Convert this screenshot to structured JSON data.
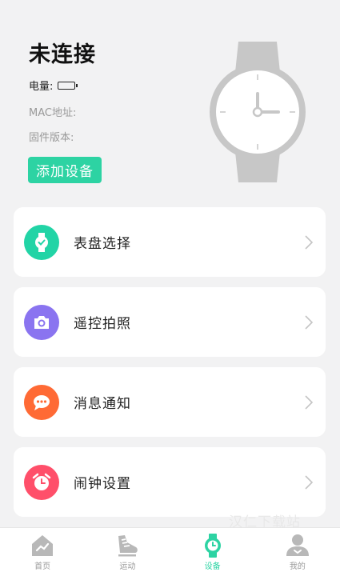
{
  "header": {
    "title": "未连接",
    "battery_label": "电量:",
    "mac_label": "MAC地址:",
    "firmware_label": "固件版本:",
    "add_device_label": "添加设备"
  },
  "menu": [
    {
      "label": "表盘选择",
      "icon": "watch-face-icon",
      "color": "#22d4a6"
    },
    {
      "label": "遥控拍照",
      "icon": "camera-icon",
      "color": "#8a74f0"
    },
    {
      "label": "消息通知",
      "icon": "message-icon",
      "color": "#ff6a35"
    },
    {
      "label": "闹钟设置",
      "icon": "alarm-icon",
      "color": "#ff4f6a"
    }
  ],
  "nav": [
    {
      "label": "首页",
      "icon": "home-icon",
      "active": false
    },
    {
      "label": "运动",
      "icon": "shoe-icon",
      "active": false
    },
    {
      "label": "设备",
      "icon": "watch-icon",
      "active": true
    },
    {
      "label": "我的",
      "icon": "user-icon",
      "active": false
    }
  ],
  "colors": {
    "accent": "#2dd3a3",
    "inactive_icon": "#b8b8b8"
  },
  "watermark": "汉仁下载站"
}
